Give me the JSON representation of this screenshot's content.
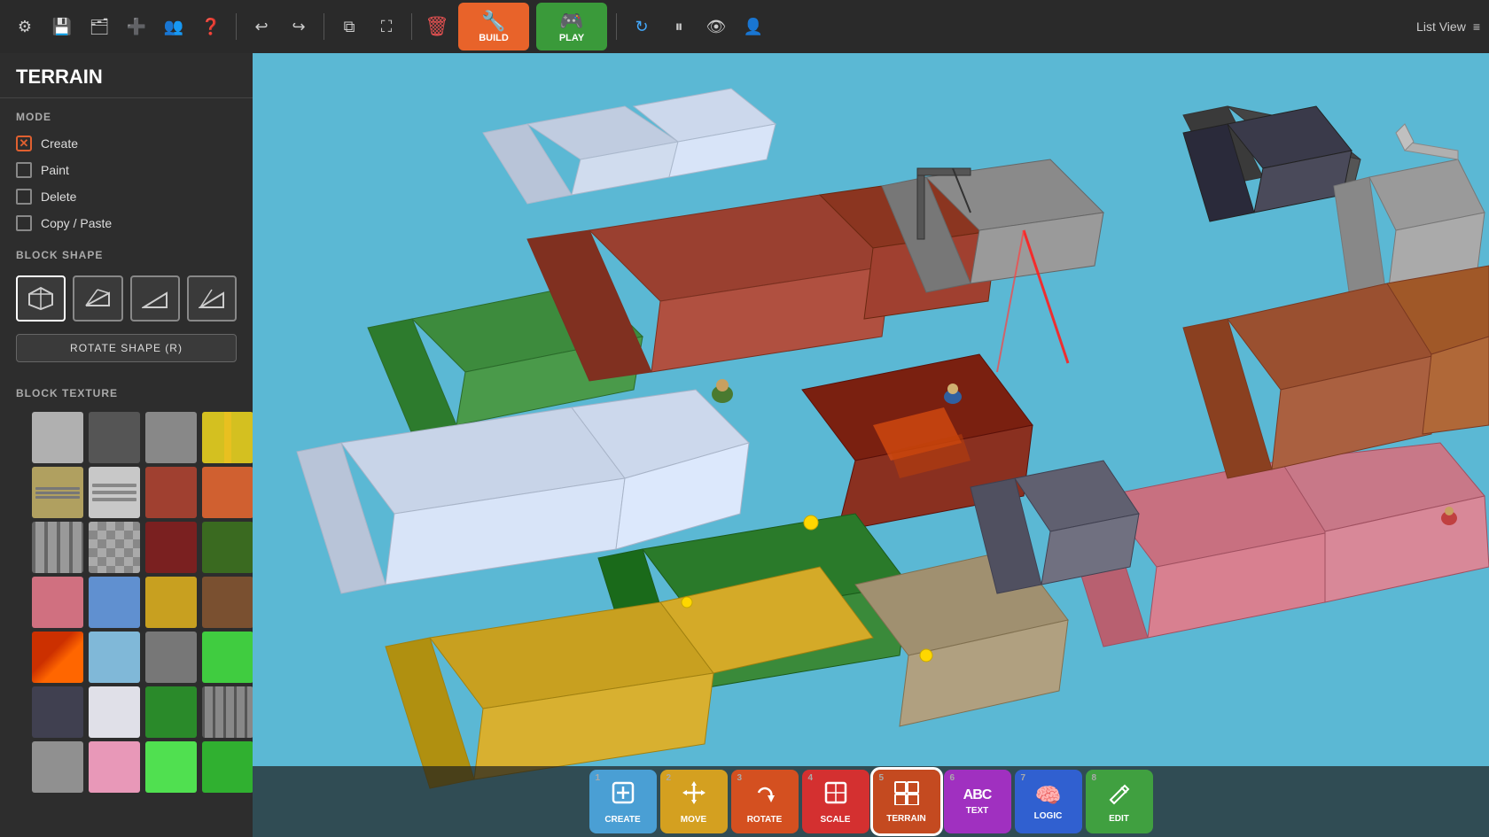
{
  "app": {
    "title": "TERRAIN"
  },
  "topbar": {
    "build_label": "BUILD",
    "play_label": "PLAY",
    "list_view_label": "List View"
  },
  "sidebar": {
    "title": "TERRAIN",
    "mode_label": "MODE",
    "modes": [
      {
        "label": "Create",
        "active": true,
        "checkbox_type": "x"
      },
      {
        "label": "Paint",
        "active": false,
        "checkbox_type": "square"
      },
      {
        "label": "Delete",
        "active": false,
        "checkbox_type": "square"
      },
      {
        "label": "Copy / Paste",
        "active": false,
        "checkbox_type": "square"
      }
    ],
    "block_shape_label": "BLOCK SHAPE",
    "rotate_shape_label": "ROTATE SHAPE (R)",
    "block_texture_label": "BLOCK TEXTURE"
  },
  "bottombar": {
    "buttons": [
      {
        "num": "1",
        "label": "CREATE",
        "icon": "⊞",
        "class": "bb-create"
      },
      {
        "num": "2",
        "label": "MOVE",
        "icon": "✛",
        "class": "bb-move"
      },
      {
        "num": "3",
        "label": "ROTATE",
        "icon": "↺",
        "class": "bb-rotate"
      },
      {
        "num": "4",
        "label": "SCALE",
        "icon": "⊡",
        "class": "bb-scale"
      },
      {
        "num": "5",
        "label": "TERRAIN",
        "icon": "▦",
        "class": "bb-terrain",
        "active": true
      },
      {
        "num": "6",
        "label": "TEXT",
        "icon": "ABC",
        "class": "bb-text"
      },
      {
        "num": "7",
        "label": "LOGIC",
        "icon": "🧠",
        "class": "bb-logic"
      },
      {
        "num": "8",
        "label": "EDIT",
        "icon": "✎",
        "class": "bb-edit"
      }
    ]
  }
}
